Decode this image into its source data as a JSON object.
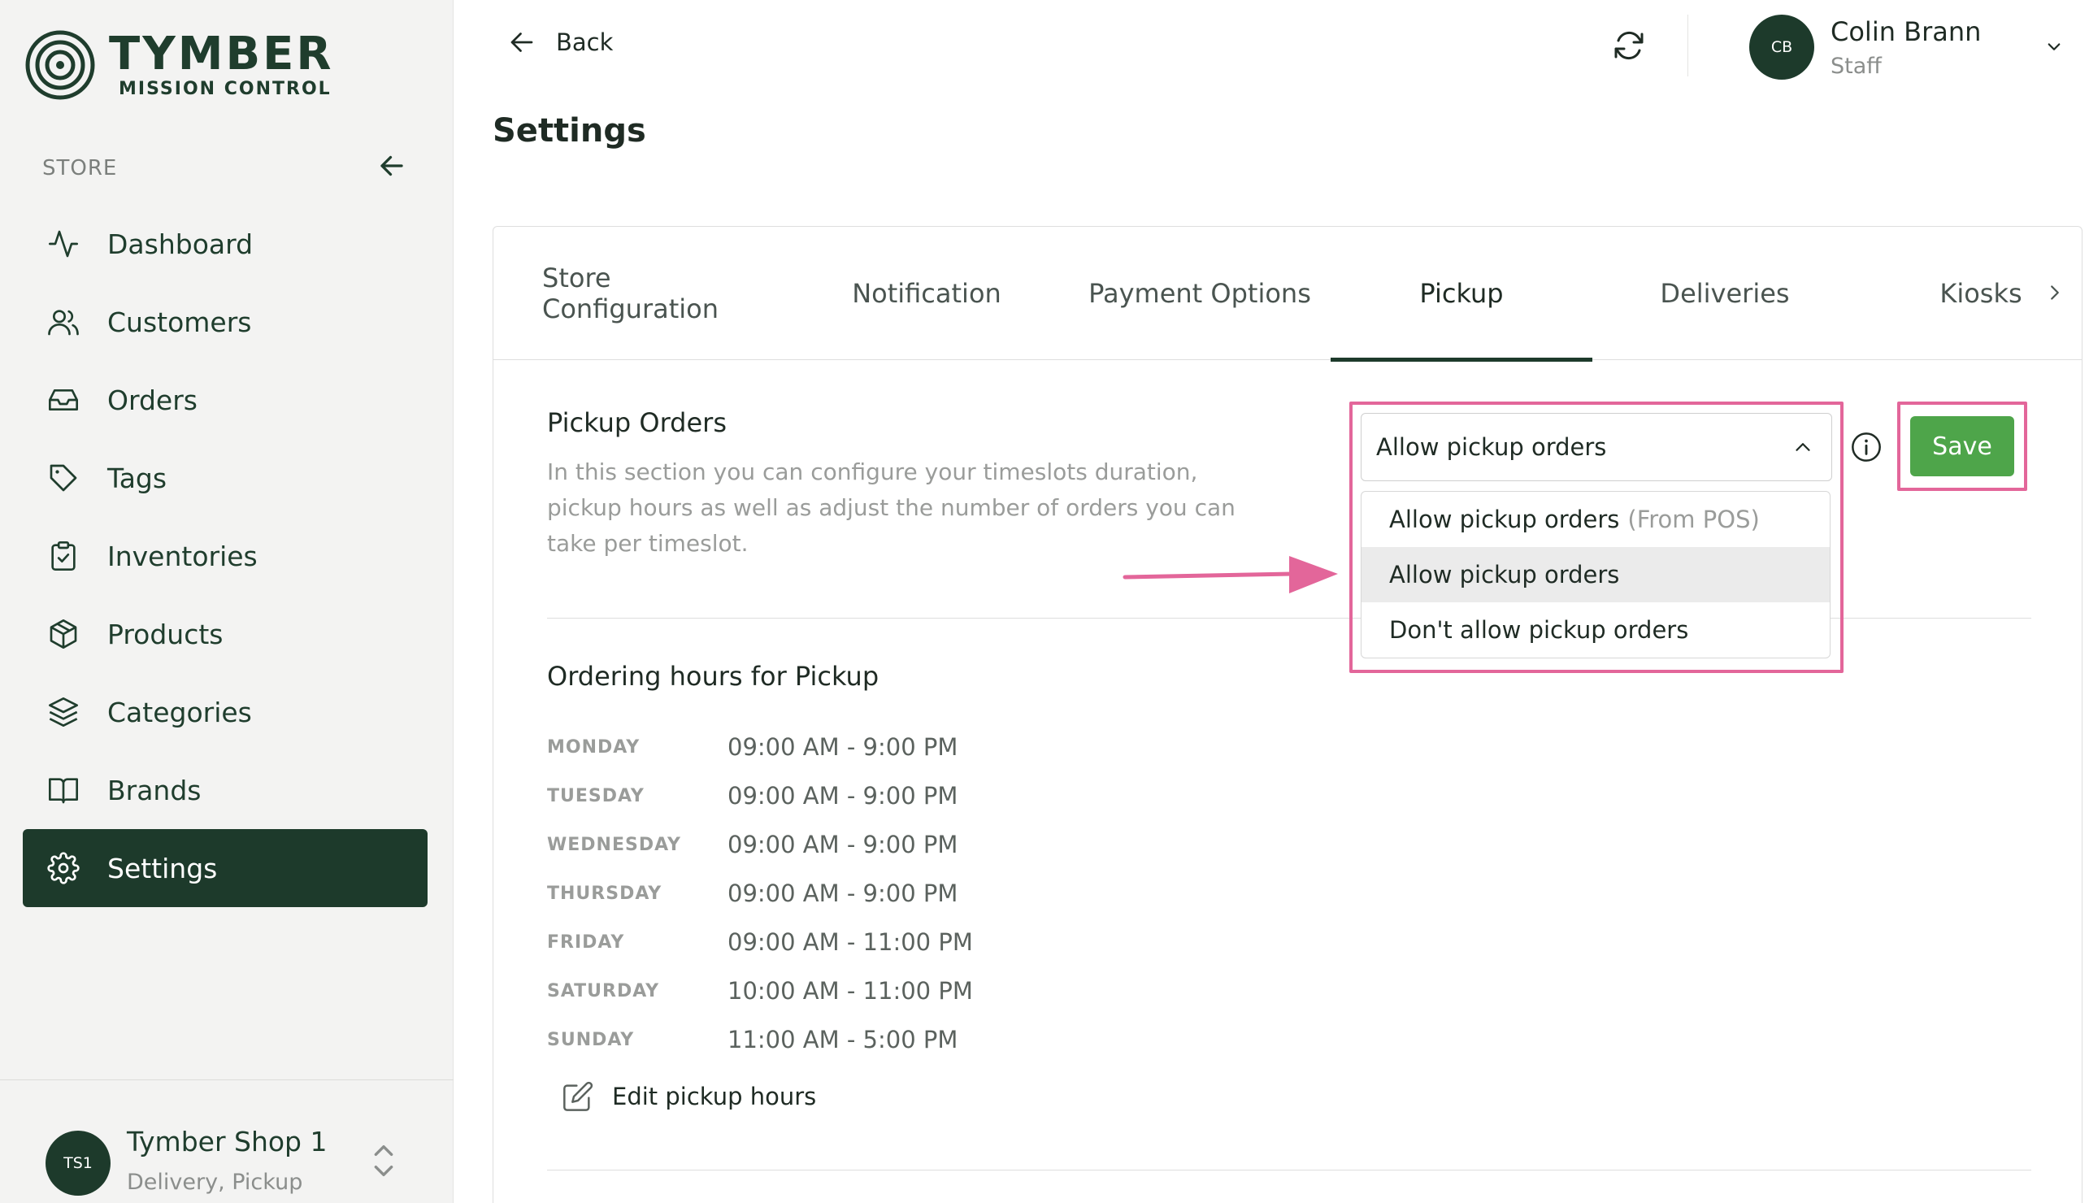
{
  "brand": {
    "title": "TYMBER",
    "subtitle": "MISSION CONTROL"
  },
  "sidebar": {
    "section_label": "STORE",
    "items": [
      {
        "label": "Dashboard",
        "icon": "activity-icon"
      },
      {
        "label": "Customers",
        "icon": "users-icon"
      },
      {
        "label": "Orders",
        "icon": "inbox-icon"
      },
      {
        "label": "Tags",
        "icon": "tag-icon"
      },
      {
        "label": "Inventories",
        "icon": "clipboard-check-icon"
      },
      {
        "label": "Products",
        "icon": "package-icon"
      },
      {
        "label": "Categories",
        "icon": "layers-icon"
      },
      {
        "label": "Brands",
        "icon": "book-open-icon"
      },
      {
        "label": "Settings",
        "icon": "gear-icon",
        "active": true
      }
    ],
    "store": {
      "initials": "TS1",
      "name": "Tymber Shop 1",
      "services": "Delivery, Pickup"
    }
  },
  "header": {
    "back_label": "Back",
    "user": {
      "initials": "CB",
      "name": "Colin Brann",
      "role": "Staff"
    }
  },
  "page_title": "Settings",
  "tabs": [
    {
      "label": "Store Configuration"
    },
    {
      "label": "Notification"
    },
    {
      "label": "Payment Options"
    },
    {
      "label": "Pickup",
      "active": true
    },
    {
      "label": "Deliveries"
    },
    {
      "label": "Kiosks"
    }
  ],
  "pickup_orders": {
    "title": "Pickup Orders",
    "description": "In this section you can configure your timeslots duration, pickup hours as well as adjust the number of orders you can take per timeslot.",
    "select_value": "Allow pickup orders",
    "options": [
      {
        "label": "Allow pickup orders",
        "note": "(From POS)"
      },
      {
        "label": "Allow pickup orders",
        "note": "",
        "selected": true
      },
      {
        "label": "Don't allow pickup orders",
        "note": ""
      }
    ],
    "save_label": "Save"
  },
  "ordering_hours": {
    "title": "Ordering hours for Pickup",
    "rows": [
      {
        "day": "MONDAY",
        "hours": "09:00 AM - 9:00 PM"
      },
      {
        "day": "TUESDAY",
        "hours": "09:00 AM - 9:00 PM"
      },
      {
        "day": "WEDNESDAY",
        "hours": "09:00 AM - 9:00 PM"
      },
      {
        "day": "THURSDAY",
        "hours": "09:00 AM - 9:00 PM"
      },
      {
        "day": "FRIDAY",
        "hours": "09:00 AM - 11:00 PM"
      },
      {
        "day": "SATURDAY",
        "hours": "10:00 AM - 11:00 PM"
      },
      {
        "day": "SUNDAY",
        "hours": "11:00 AM - 5:00 PM"
      }
    ],
    "edit_label": "Edit pickup hours"
  },
  "colors": {
    "brand_dark": "#1d3a2b",
    "save_green": "#4ea54a",
    "highlight_pink": "#e3669a"
  }
}
